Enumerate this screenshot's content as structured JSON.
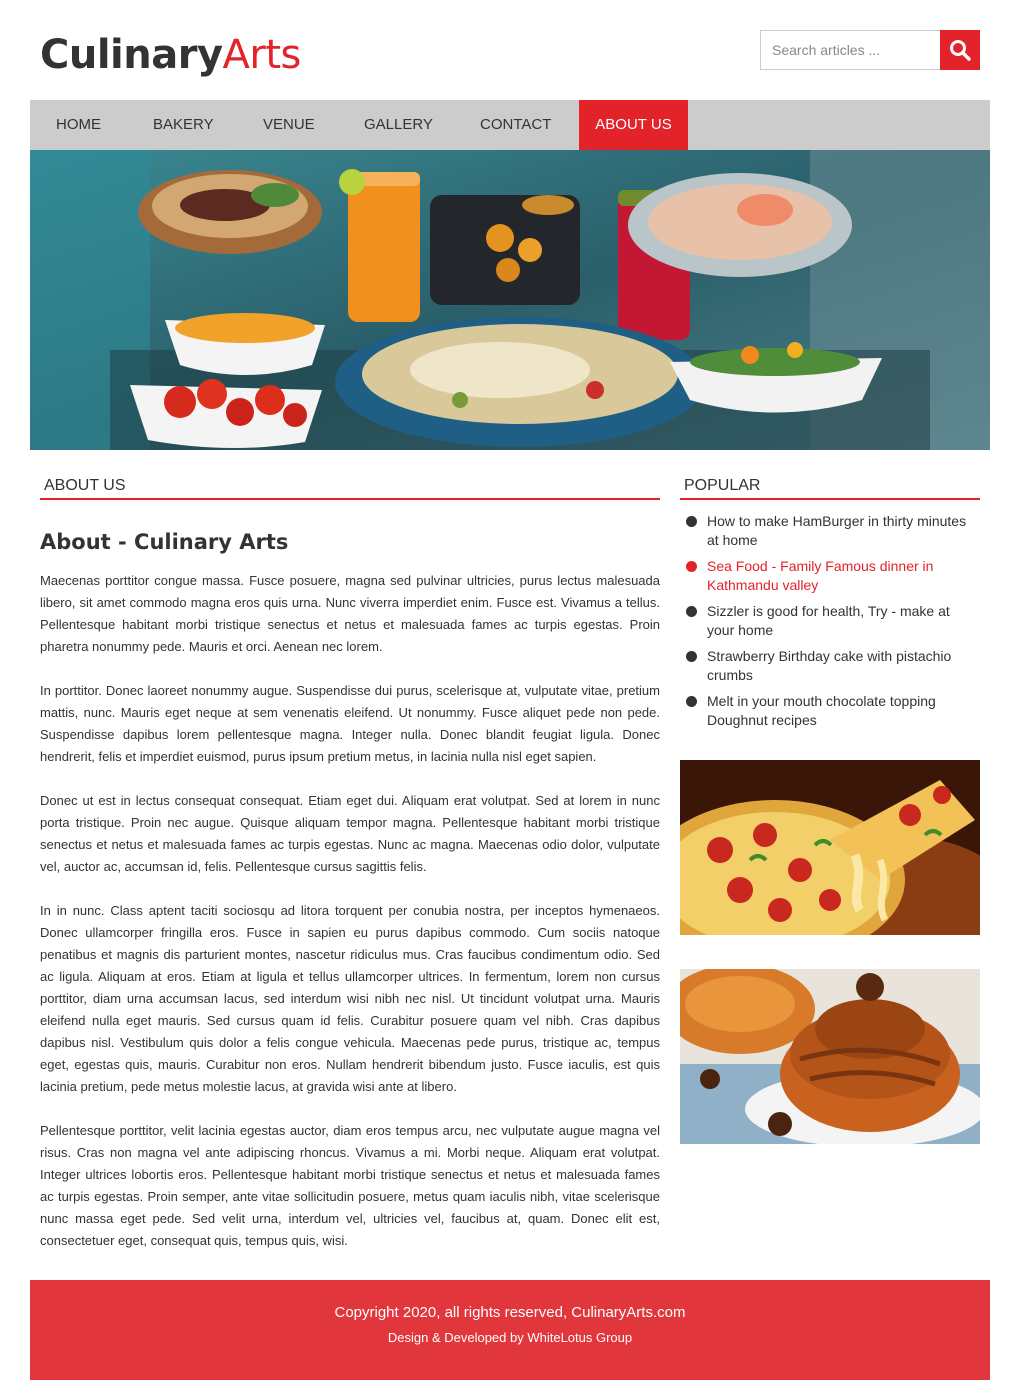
{
  "brand": {
    "part1": "Culinary",
    "part2": "Arts"
  },
  "search": {
    "placeholder": "Search articles ...",
    "icon": "search-icon"
  },
  "nav": {
    "items": [
      "HOME",
      "BAKERY",
      "VENUE",
      "GALLERY",
      "CONTACT",
      "ABOUT US"
    ],
    "active": "ABOUT US"
  },
  "main": {
    "section_title": "ABOUT US",
    "heading": "About - Culinary Arts",
    "paragraphs": [
      "Maecenas porttitor congue massa. Fusce posuere, magna sed pulvinar ultricies, purus lectus malesuada libero, sit amet commodo magna eros quis urna. Nunc viverra imperdiet enim. Fusce est. Vivamus a tellus. Pellentesque habitant morbi tristique senectus et netus et malesuada fames ac turpis egestas. Proin pharetra nonummy pede. Mauris et orci. Aenean nec lorem.",
      "In porttitor. Donec laoreet nonummy augue. Suspendisse dui purus, scelerisque at, vulputate vitae, pretium mattis, nunc. Mauris eget neque at sem venenatis eleifend. Ut nonummy. Fusce aliquet pede non pede. Suspendisse dapibus lorem pellentesque magna. Integer nulla. Donec blandit feugiat ligula. Donec hendrerit, felis et imperdiet euismod, purus ipsum pretium metus, in lacinia nulla nisl eget sapien.",
      "Donec ut est in lectus consequat consequat. Etiam eget dui. Aliquam erat volutpat. Sed at lorem in nunc porta tristique. Proin nec augue. Quisque aliquam tempor magna. Pellentesque habitant morbi tristique senectus et netus et malesuada fames ac turpis egestas. Nunc ac magna. Maecenas odio dolor, vulputate vel, auctor ac, accumsan id, felis. Pellentesque cursus sagittis felis.",
      "In in nunc. Class aptent taciti sociosqu ad litora torquent per conubia nostra, per inceptos hymenaeos. Donec ullamcorper fringilla eros. Fusce in sapien eu purus dapibus commodo. Cum sociis natoque penatibus et magnis dis parturient montes, nascetur ridiculus mus. Cras faucibus condimentum odio. Sed ac ligula. Aliquam at eros. Etiam at ligula et tellus ullamcorper ultrices. In fermentum, lorem non cursus porttitor, diam urna accumsan lacus, sed interdum wisi nibh nec nisl. Ut tincidunt volutpat urna. Mauris eleifend nulla eget mauris. Sed cursus quam id felis. Curabitur posuere quam vel nibh. Cras dapibus dapibus nisl. Vestibulum quis dolor a felis congue vehicula. Maecenas pede purus, tristique ac, tempus eget, egestas quis, mauris. Curabitur non eros. Nullam hendrerit bibendum justo. Fusce iaculis, est quis lacinia pretium, pede metus molestie lacus, at gravida wisi ante at libero.",
      "Pellentesque porttitor, velit lacinia egestas auctor, diam eros tempus arcu, nec vulputate augue magna vel risus. Cras non magna vel ante adipiscing rhoncus. Vivamus a mi. Morbi neque. Aliquam erat volutpat. Integer ultrices lobortis eros. Pellentesque habitant morbi tristique senectus et netus et malesuada fames ac turpis egestas. Proin semper, ante vitae sollicitudin posuere, metus quam iaculis nibh, vitae scelerisque nunc massa eget pede. Sed velit urna, interdum vel, ultricies vel, faucibus at, quam. Donec elit est, consectetuer eget, consequat quis, tempus quis, wisi."
    ]
  },
  "sidebar": {
    "section_title": "POPULAR",
    "items": [
      "How to make HamBurger in thirty minutes at home",
      "Sea Food - Family Famous dinner in Kathmandu valley",
      "Sizzler is good for health, Try - make at your home",
      "Strawberry Birthday cake with pistachio crumbs",
      "Melt in your mouth chocolate topping Doughnut recipes"
    ],
    "highlighted_index": 1
  },
  "footer": {
    "copyright": "Copyright 2020, all rights reserved, CulinaryArts.com",
    "credit": "Design & Developed by WhiteLotus Group"
  },
  "colors": {
    "accent": "#e2232a",
    "footer_bg": "#e2363d",
    "nav_bg": "#cccccc",
    "text": "#333333"
  }
}
